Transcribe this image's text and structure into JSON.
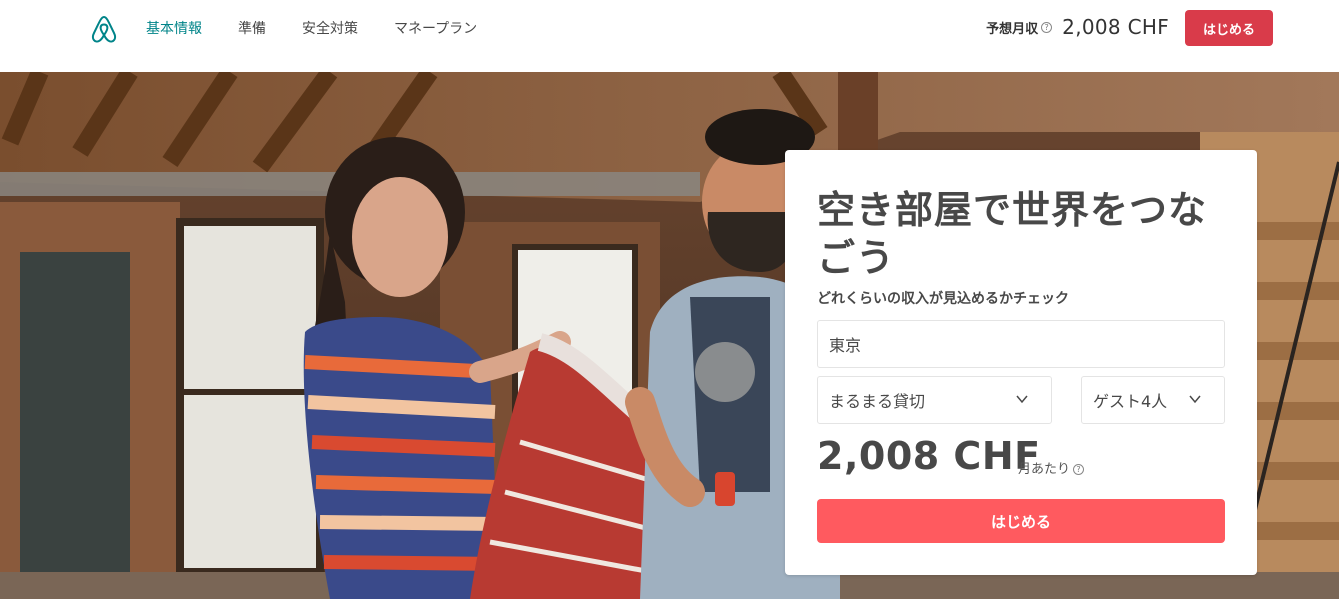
{
  "header": {
    "nav": [
      {
        "label": "基本情報",
        "active": true
      },
      {
        "label": "準備",
        "active": false
      },
      {
        "label": "安全対策",
        "active": false
      },
      {
        "label": "マネープラン",
        "active": false
      }
    ],
    "estimate_label": "予想月収",
    "estimate_value": "2,008 CHF",
    "start_label": "はじめる"
  },
  "card": {
    "headline": "空き部屋で世界をつなごう",
    "subheadline": "どれくらいの収入が見込めるかチェック",
    "city_value": "東京",
    "listing_type_value": "まるまる貸切",
    "guests_value": "ゲスト4人",
    "price_value": "2,008 CHF",
    "per_month_label": "月あたり",
    "start_label": "はじめる"
  },
  "colors": {
    "brand_teal": "#008489",
    "header_button": "#D93B4A",
    "cta_button": "#FF5A5F"
  },
  "icons": {
    "logo": "airbnb-belo-icon",
    "help": "question-circle-icon",
    "dropdown": "chevron-down-icon"
  }
}
